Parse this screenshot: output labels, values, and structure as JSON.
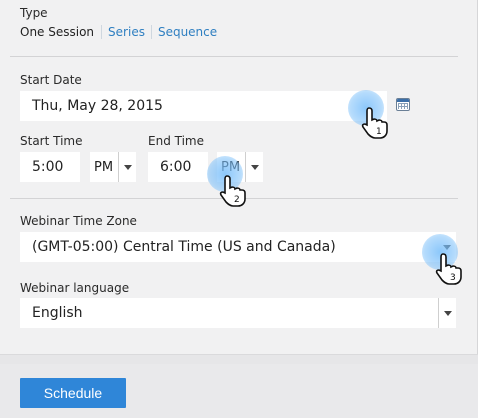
{
  "type": {
    "label": "Type",
    "current": "One Session",
    "options": [
      "Series",
      "Sequence"
    ]
  },
  "start_date": {
    "label": "Start Date",
    "value": "Thu, May 28, 2015",
    "calendar_icon": "calendar-icon"
  },
  "start_time": {
    "label": "Start Time",
    "value": "5:00",
    "ampm": "PM"
  },
  "end_time": {
    "label": "End Time",
    "value": "6:00",
    "ampm": "PM"
  },
  "timezone": {
    "label": "Webinar Time Zone",
    "value": "(GMT-05:00) Central Time (US and Canada)"
  },
  "language": {
    "label": "Webinar language",
    "value": "English"
  },
  "footer": {
    "schedule_label": "Schedule"
  },
  "annotations": {
    "step1": "1",
    "step2": "2",
    "step3": "3",
    "accent": "#2f86d8",
    "link_color": "#2f7fc1"
  }
}
